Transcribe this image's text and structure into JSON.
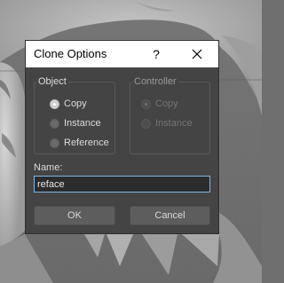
{
  "dialog": {
    "title": "Clone Options",
    "help_label": "?",
    "close_icon": "close-icon"
  },
  "object_group": {
    "label": "Object",
    "options": [
      {
        "label": "Copy",
        "checked": true
      },
      {
        "label": "Instance",
        "checked": false
      },
      {
        "label": "Reference",
        "checked": false
      }
    ]
  },
  "controller_group": {
    "label": "Controller",
    "enabled": false,
    "options": [
      {
        "label": "Copy",
        "checked": true
      },
      {
        "label": "Instance",
        "checked": false
      }
    ]
  },
  "name": {
    "label": "Name:",
    "value": "reface"
  },
  "buttons": {
    "ok": "OK",
    "cancel": "Cancel"
  },
  "colors": {
    "dialog_bg": "#444444",
    "titlebar_bg": "#ffffff",
    "input_focus_border": "#7db7e8",
    "group_label_object": "#dcdcdc",
    "group_label_controller": "#9a9a9a"
  }
}
